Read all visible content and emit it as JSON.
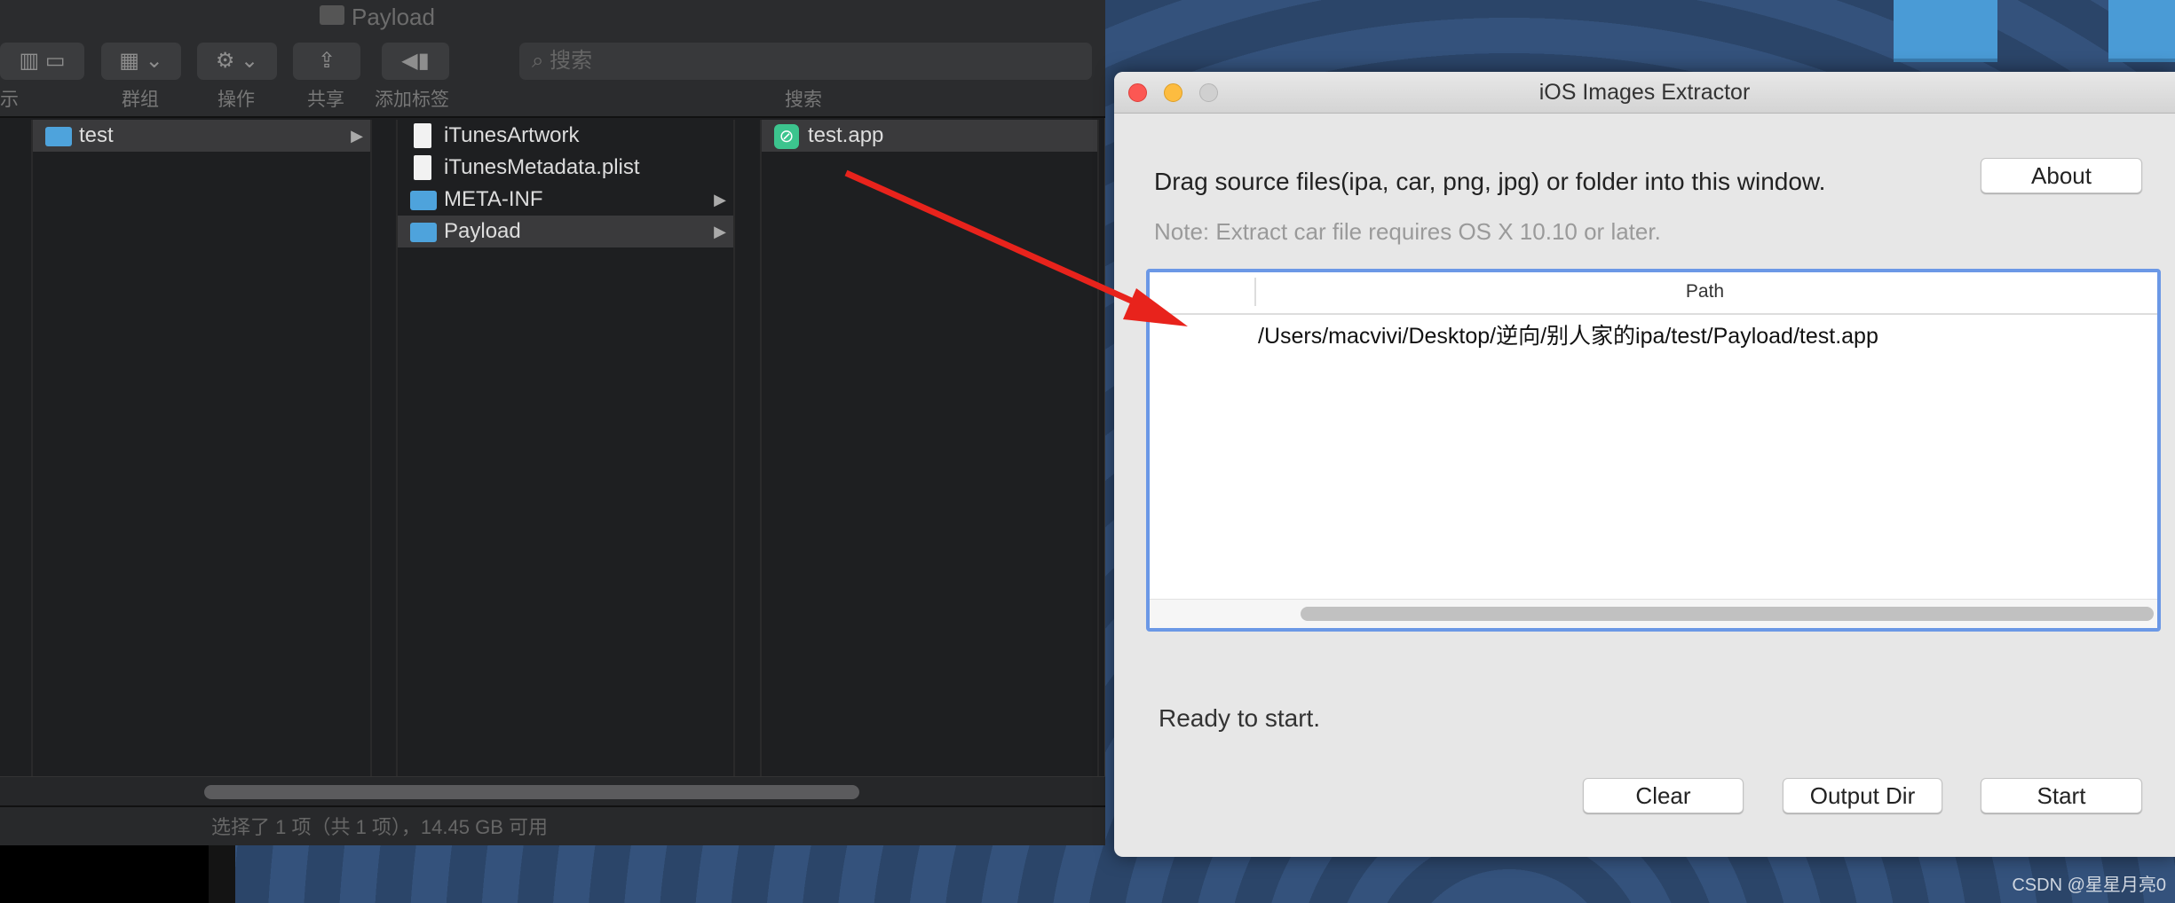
{
  "finder": {
    "title": "Payload",
    "toolbar": {
      "view_label": "示",
      "group_label": "群组",
      "action_label": "操作",
      "share_label": "共享",
      "tag_label": "添加标签",
      "search_placeholder": "搜索",
      "search_label": "搜索"
    },
    "columns": [
      [
        {
          "name": "test",
          "type": "folder",
          "selected": true,
          "has_children": true
        }
      ],
      [
        {
          "name": "iTunesArtwork",
          "type": "file"
        },
        {
          "name": "iTunesMetadata.plist",
          "type": "plist"
        },
        {
          "name": "META-INF",
          "type": "folder",
          "has_children": true
        },
        {
          "name": "Payload",
          "type": "folder",
          "selected": true,
          "has_children": true
        }
      ],
      [
        {
          "name": "test.app",
          "type": "app",
          "selected": true
        }
      ]
    ],
    "status": "选择了 1 项（共 1 项），14.45 GB 可用"
  },
  "extractor": {
    "title": "iOS Images Extractor",
    "instruction": "Drag source files(ipa, car, png, jpg) or folder into this window.",
    "note": "Note: Extract car file requires OS X 10.10 or later.",
    "about_label": "About",
    "table": {
      "header": "Path",
      "rows": [
        "/Users/macvivi/Desktop/逆向/别人家的ipa/test/Payload/test.app"
      ]
    },
    "status": "Ready to start.",
    "clear_label": "Clear",
    "output_label": "Output Dir",
    "start_label": "Start"
  },
  "annotation": {
    "arrow_color": "#e8231c"
  },
  "watermark": "CSDN @星星月亮0"
}
